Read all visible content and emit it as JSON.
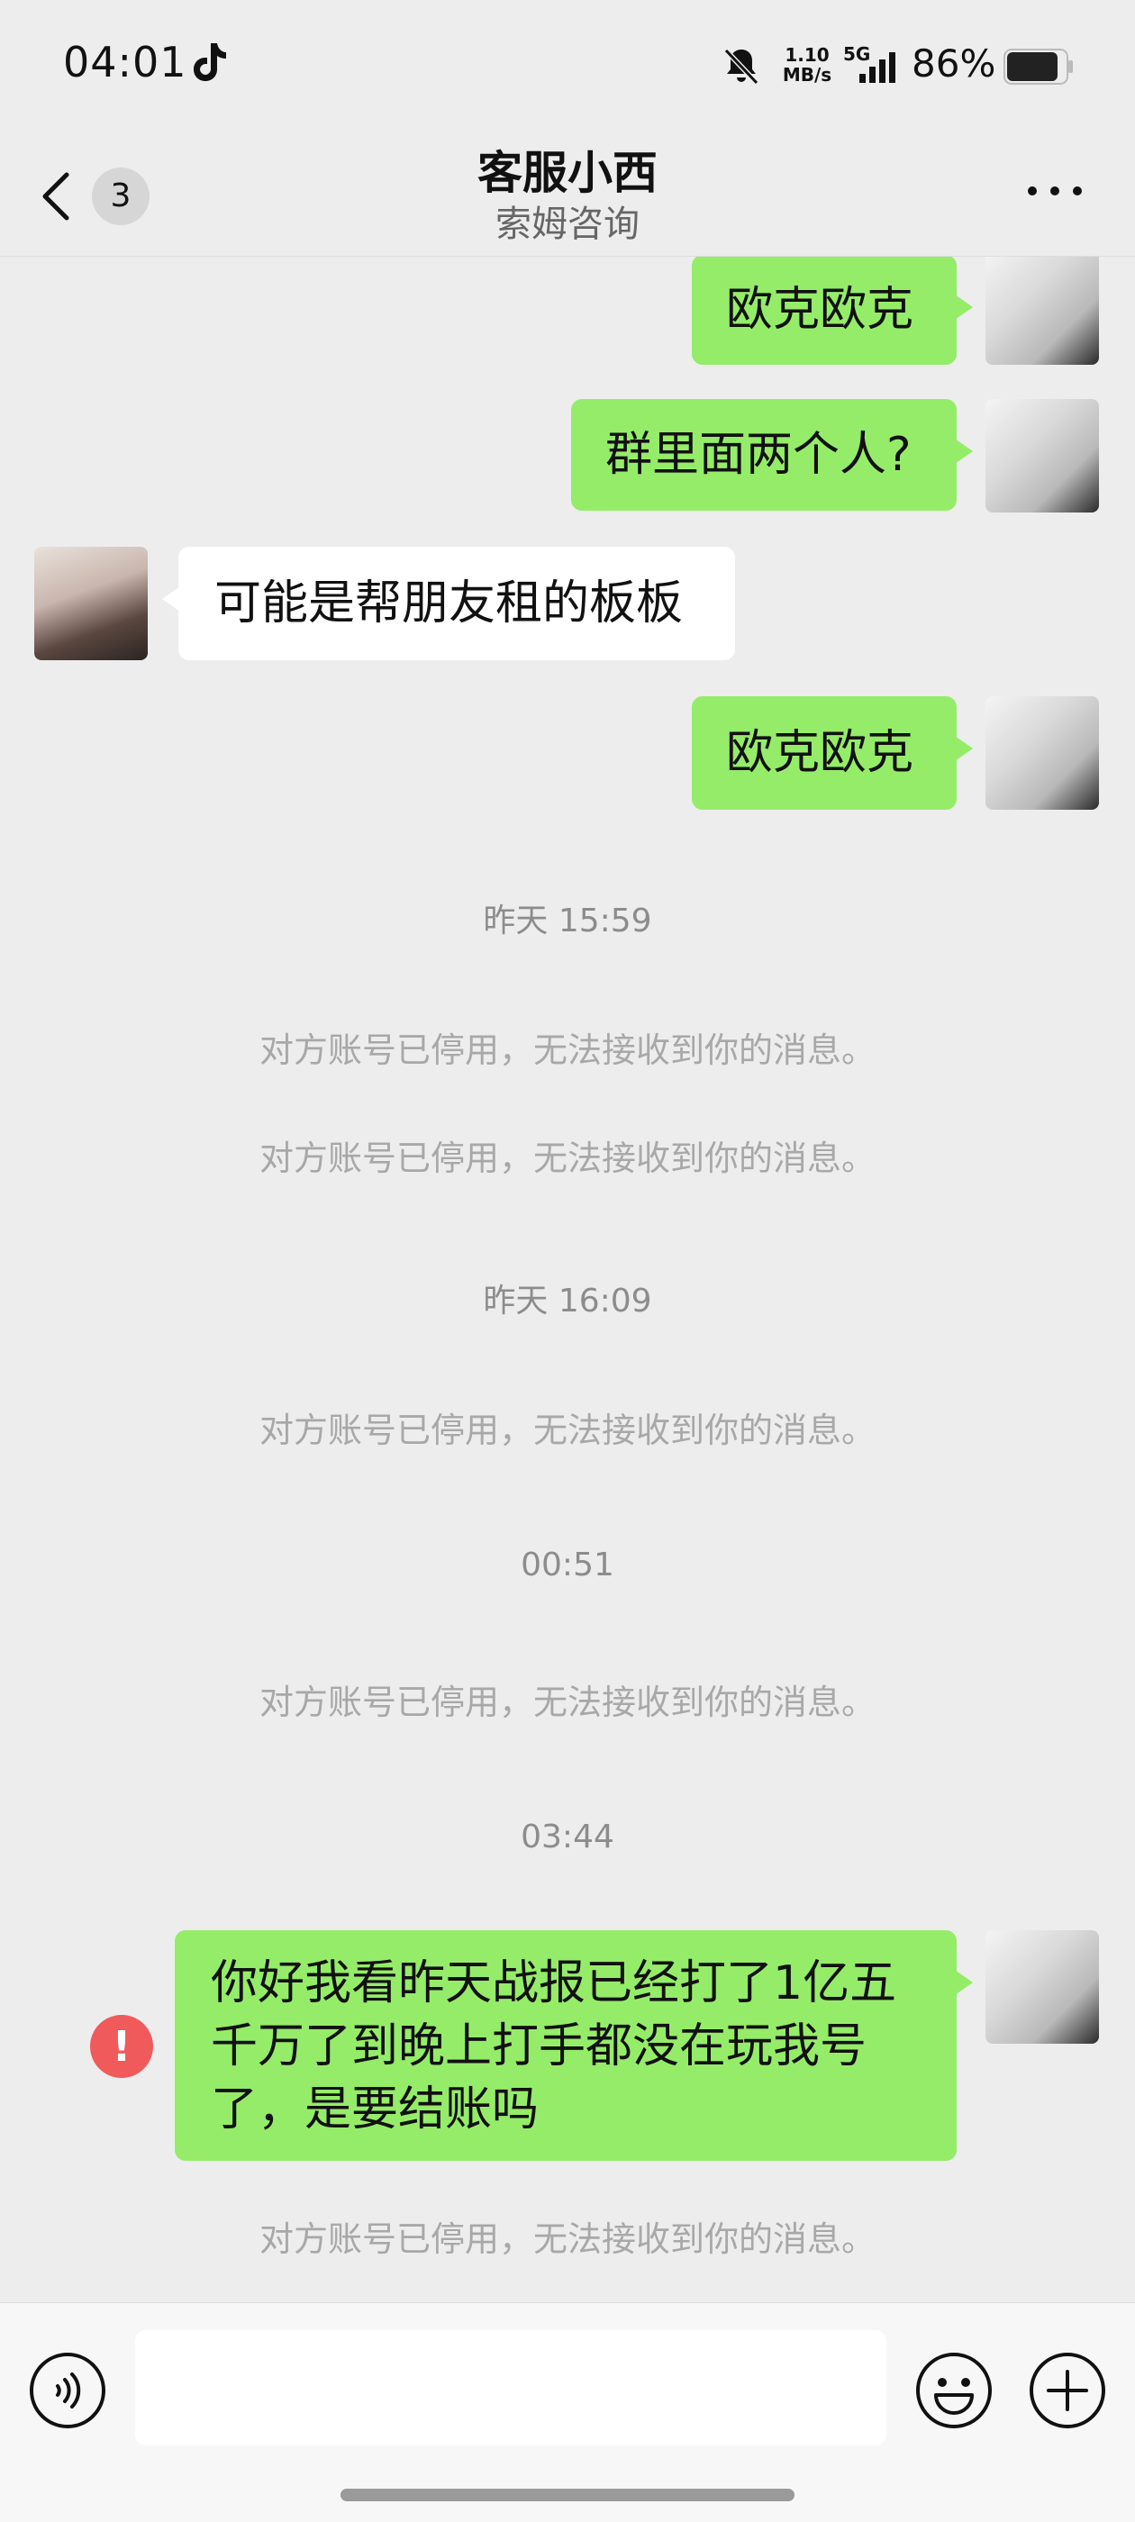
{
  "status_bar": {
    "time": "04:01",
    "net_speed_value": "1.10",
    "net_speed_unit": "MB/s",
    "network": "5G",
    "battery": "86%"
  },
  "nav": {
    "back_badge": "3",
    "title": "客服小西",
    "subtitle": "索姆咨询"
  },
  "messages": {
    "m1": "欧克欧克",
    "m2": "群里面两个人?",
    "m3": "可能是帮朋友租的板板",
    "m4": "欧克欧克",
    "t1": "昨天 15:59",
    "s1": "对方账号已停用，无法接收到你的消息。",
    "s2": "对方账号已停用，无法接收到你的消息。",
    "t2": "昨天 16:09",
    "s3": "对方账号已停用，无法接收到你的消息。",
    "t3": "00:51",
    "s4": "对方账号已停用，无法接收到你的消息。",
    "t4": "03:44",
    "m5_line1": "你好我看昨天战报已经打了1亿五",
    "m5_line2": "千万了到晚上打手都没在玩我号",
    "m5_line3": "了，是要结账吗",
    "s5": "对方账号已停用，无法接收到你的消息。"
  },
  "input": {
    "placeholder": ""
  },
  "colors": {
    "bubble_me": "#95ec69",
    "bubble_other": "#ffffff",
    "background": "#ededed",
    "error": "#f05a5a"
  }
}
